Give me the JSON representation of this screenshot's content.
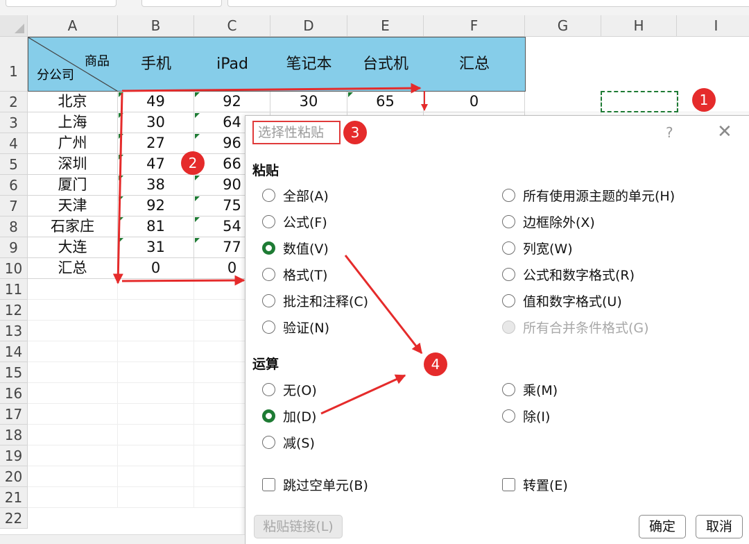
{
  "columns": [
    "A",
    "B",
    "C",
    "D",
    "E",
    "F",
    "G",
    "H",
    "I"
  ],
  "rows": [
    "1",
    "2",
    "3",
    "4",
    "5",
    "6",
    "7",
    "8",
    "9",
    "10",
    "11",
    "12",
    "13",
    "14",
    "15",
    "16",
    "17",
    "18",
    "19",
    "20",
    "21",
    "22"
  ],
  "header": {
    "a_top": "商品",
    "a_bottom": "分公司",
    "b": "手机",
    "c": "iPad",
    "d": "笔记本",
    "e": "台式机",
    "f": "汇总"
  },
  "data_rows": [
    {
      "name": "北京",
      "b": "49",
      "c": "92",
      "d": "30",
      "e": "65",
      "f": "0"
    },
    {
      "name": "上海",
      "b": "30",
      "c": "64"
    },
    {
      "name": "广州",
      "b": "27",
      "c": "96"
    },
    {
      "name": "深圳",
      "b": "47",
      "c": "66"
    },
    {
      "name": "厦门",
      "b": "38",
      "c": "90"
    },
    {
      "name": "天津",
      "b": "92",
      "c": "75"
    },
    {
      "name": "石家庄",
      "b": "81",
      "c": "54"
    },
    {
      "name": "大连",
      "b": "31",
      "c": "77"
    },
    {
      "name": "汇总",
      "b": "0",
      "c": "0"
    }
  ],
  "badges": [
    "1",
    "2",
    "3",
    "4"
  ],
  "dialog": {
    "title": "选择性粘贴",
    "help": "?",
    "close": "✕",
    "paste_section": "粘贴",
    "paste_left": [
      "全部(A)",
      "公式(F)",
      "数值(V)",
      "格式(T)",
      "批注和注释(C)",
      "验证(N)"
    ],
    "paste_right": [
      "所有使用源主题的单元(H)",
      "边框除外(X)",
      "列宽(W)",
      "公式和数字格式(R)",
      "值和数字格式(U)",
      "所有合并条件格式(G)"
    ],
    "paste_selected": "数值(V)",
    "op_section": "运算",
    "op_left": [
      "无(O)",
      "加(D)",
      "减(S)"
    ],
    "op_right": [
      "乘(M)",
      "除(I)"
    ],
    "op_selected": "加(D)",
    "skip_blanks": "跳过空单元(B)",
    "transpose": "转置(E)",
    "paste_link": "粘贴链接(L)",
    "ok": "确定",
    "cancel": "取消"
  },
  "colors": {
    "header_fill": "#86cde9",
    "accent_green": "#1e7b34",
    "annotation_red": "#e52b2b"
  }
}
